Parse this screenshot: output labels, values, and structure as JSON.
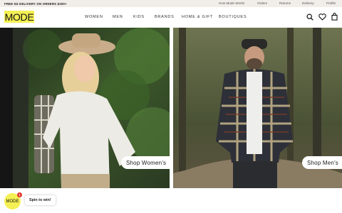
{
  "topbar": {
    "promo": "FREE NZ DELIVERY ON ORDERS $200+",
    "links": [
      "How Mode Works",
      "Orders",
      "Returns",
      "Delivery",
      "Profile"
    ]
  },
  "header": {
    "logo": "MODE",
    "nav": [
      "WOMEN",
      "MEN",
      "KIDS",
      "BRANDS",
      "HOME & GIFT",
      "BOUTIQUES"
    ],
    "icons": [
      "search-icon",
      "heart-icon",
      "shopping-bag-icon"
    ]
  },
  "hero": {
    "left_cta": "Shop Women's",
    "right_cta": "Shop Men's"
  },
  "widget": {
    "badge_label": "MODE",
    "notification_count": "1",
    "spin_label": "Spin to win!"
  },
  "colors": {
    "brand_yellow": "#f4f054",
    "topbar_bg": "#f1ede8",
    "notification_red": "#e0342c"
  }
}
